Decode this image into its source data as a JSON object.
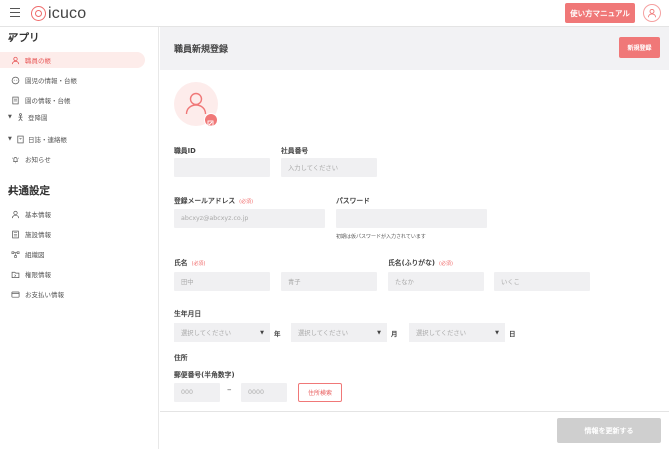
{
  "header": {
    "logo_text": "icuco",
    "manual_button": "使い方マニュアル"
  },
  "sidebar": {
    "sections": [
      {
        "label": "アプリ",
        "items": [
          {
            "label": "職員の帳",
            "icon": "person-icon",
            "active": true
          },
          {
            "label": "園児の情報・台帳",
            "icon": "child-face-icon",
            "expandable": false
          },
          {
            "label": "園の情報・台帳",
            "icon": "document-icon",
            "expandable": false
          },
          {
            "label": "登降園",
            "icon": "walk-icon",
            "expandable": true
          },
          {
            "label": "日誌・連絡帳",
            "icon": "notebook-icon",
            "expandable": true
          },
          {
            "label": "お知らせ",
            "icon": "bell-icon",
            "expandable": false
          }
        ]
      },
      {
        "label": "共通設定",
        "items": [
          {
            "label": "基本情報",
            "icon": "person-outline-icon"
          },
          {
            "label": "施設情報",
            "icon": "building-icon"
          },
          {
            "label": "組織図",
            "icon": "org-chart-icon"
          },
          {
            "label": "権限情報",
            "icon": "folder-key-icon"
          },
          {
            "label": "お支払い情報",
            "icon": "credit-card-icon"
          }
        ]
      }
    ]
  },
  "main": {
    "title": "職員新規登録",
    "new_button": "新規登録",
    "form": {
      "staff_id": {
        "label": "職員ID",
        "value": ""
      },
      "employee_number": {
        "label": "社員番号",
        "placeholder": "入力してください"
      },
      "email": {
        "label": "登録メールアドレス",
        "required": "(必須)",
        "placeholder": "abcxyz@abcxyz.co.jp"
      },
      "password": {
        "label": "パスワード",
        "note": "初期は仮パスワードが入力されています"
      },
      "name": {
        "label": "氏名",
        "required": "(必須)",
        "last_placeholder": "田中",
        "first_placeholder": "青子"
      },
      "name_kana": {
        "label": "氏名(ふりがな)",
        "required": "(必須)",
        "last_placeholder": "たなか",
        "first_placeholder": "いくこ"
      },
      "birthdate": {
        "label": "生年月日",
        "year_placeholder": "選択してください",
        "month_placeholder": "選択してください",
        "day_placeholder": "選択してください",
        "year_unit": "年",
        "month_unit": "月",
        "day_unit": "日"
      },
      "address": {
        "label": "住所",
        "postal_label": "郵便番号(半角数字)",
        "postal_first_placeholder": "000",
        "postal_dash": "–",
        "postal_second_placeholder": "0000",
        "search_button": "住所検索"
      }
    },
    "update_button": "情報を更新する"
  },
  "colors": {
    "accent": "#f07878",
    "active_bg": "#fdecea",
    "input_bg": "#f0f0f2",
    "disabled_button": "#cfcfcf"
  }
}
